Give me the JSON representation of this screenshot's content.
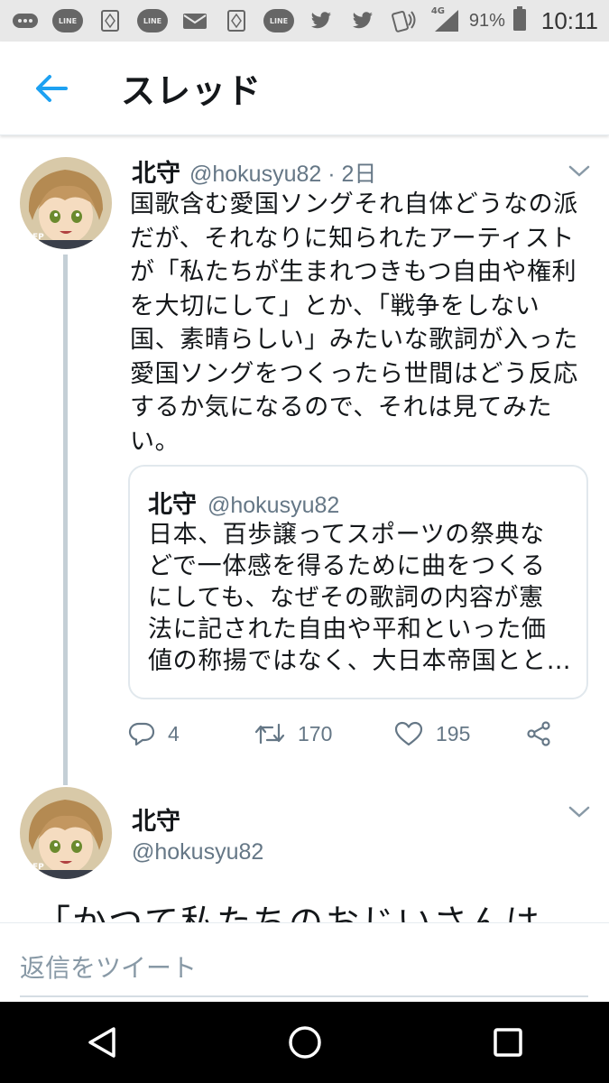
{
  "status_bar": {
    "icons": [
      "more-icon",
      "line-icon",
      "app-icon",
      "line-icon",
      "mail-icon",
      "app-icon",
      "line-icon",
      "twitter-icon",
      "twitter-icon",
      "nfc-icon",
      "signal-icon"
    ],
    "line_label": "LINE",
    "network": "4G",
    "battery": "91%",
    "time": "10:11"
  },
  "header": {
    "title": "スレッド"
  },
  "tweet1": {
    "name": "北守",
    "handle": "@hokusyu82 · 2日",
    "lines": [
      "国歌含む愛国ソングそれ自体どうなの派",
      "だが、それなりに知られたアーティスト",
      "が「私たちが生まれつきもつ自由や権利",
      "を大切にして」とか、「戦争をしない",
      "国、素晴らしい」みたいな歌詞が入った",
      "愛国ソングをつくったら世間はどう反応",
      "するか気になるので、それは見てみた",
      "い。"
    ],
    "quote": {
      "name": "北守",
      "handle": "@hokusyu82",
      "lines": [
        "日本、百歩譲ってスポーツの祭典な",
        "どで一体感を得るために曲をつくる",
        "にしても、なぜその歌詞の内容が憲",
        "法に記された自由や平和といった価",
        "値の称揚ではなく、大日本帝国とと…"
      ]
    },
    "actions": {
      "replies": "4",
      "retweets": "170",
      "likes": "195"
    }
  },
  "tweet2": {
    "name": "北守",
    "handle": "@hokusyu82",
    "text_partial": "「かつて私たちのおじいさんは"
  },
  "avatar_badge": "FP",
  "reply": {
    "placeholder": "返信をツイート"
  },
  "colors": {
    "accent": "#1da1f2",
    "muted": "#657786",
    "thread_line": "#c4cfd6"
  }
}
